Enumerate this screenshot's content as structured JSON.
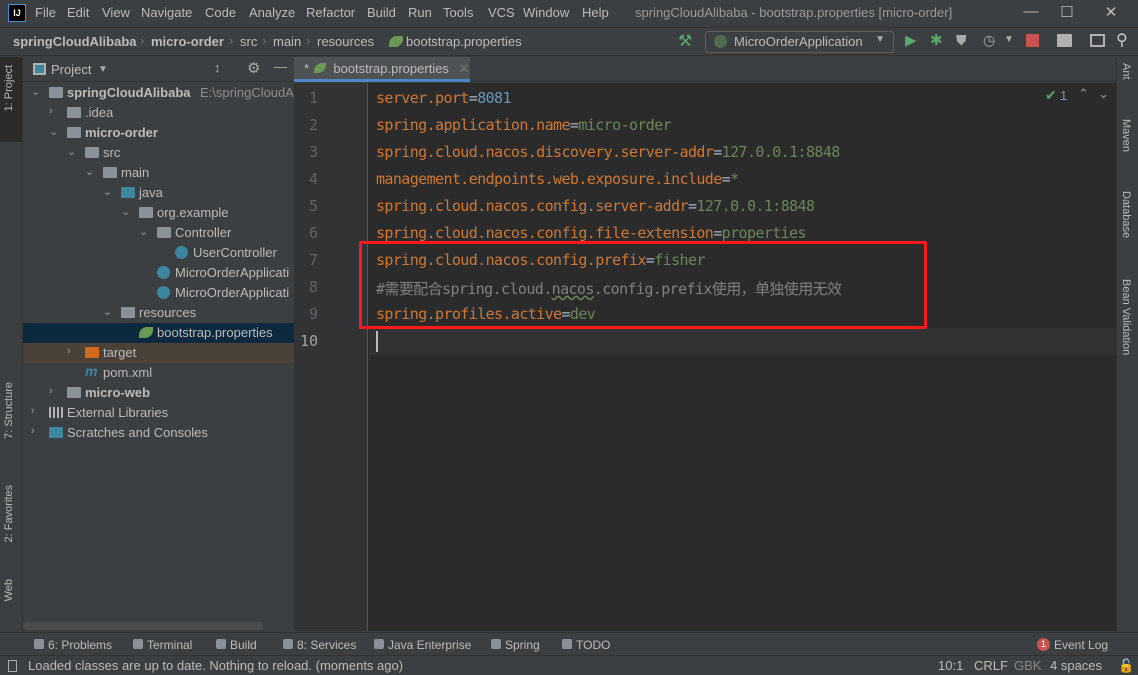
{
  "app": {
    "logo": "IJ",
    "window_title": "springCloudAlibaba - bootstrap.properties [micro-order]"
  },
  "menu": [
    "File",
    "Edit",
    "View",
    "Navigate",
    "Code",
    "Analyze",
    "Refactor",
    "Build",
    "Run",
    "Tools",
    "VCS",
    "Window",
    "Help"
  ],
  "breadcrumbs": [
    "springCloudAlibaba",
    "micro-order",
    "src",
    "main",
    "resources",
    "bootstrap.properties"
  ],
  "toolbar": {
    "run_config": "MicroOrderApplication"
  },
  "left_tabs": [
    "1: Project",
    "7: Structure",
    "2: Favorites",
    "Web"
  ],
  "right_tabs": [
    "Ant",
    "Maven",
    "Database",
    "Bean Validation"
  ],
  "project": {
    "title": "Project",
    "tree": [
      {
        "label": "springCloudAlibaba",
        "hint": "E:\\springCloudAli",
        "depth": 0,
        "state": "open",
        "icon": "module-folder",
        "bold": true
      },
      {
        "label": ".idea",
        "depth": 1,
        "state": "closed",
        "icon": "folder"
      },
      {
        "label": "micro-order",
        "depth": 1,
        "state": "open",
        "icon": "module-folder",
        "bold": true
      },
      {
        "label": "src",
        "depth": 2,
        "state": "open",
        "icon": "folder"
      },
      {
        "label": "main",
        "depth": 3,
        "state": "open",
        "icon": "folder"
      },
      {
        "label": "java",
        "depth": 4,
        "state": "open",
        "icon": "source-folder"
      },
      {
        "label": "org.example",
        "depth": 5,
        "state": "open",
        "icon": "package"
      },
      {
        "label": "Controller",
        "depth": 6,
        "state": "open",
        "icon": "package"
      },
      {
        "label": "UserController",
        "depth": 7,
        "state": "leaf",
        "icon": "class"
      },
      {
        "label": "MicroOrderApplicati",
        "depth": 6,
        "state": "leaf",
        "icon": "spring-boot-class"
      },
      {
        "label": "MicroOrderApplicati",
        "depth": 6,
        "state": "leaf",
        "icon": "spring-boot-class"
      },
      {
        "label": "resources",
        "depth": 4,
        "state": "open",
        "icon": "resources-folder"
      },
      {
        "label": "bootstrap.properties",
        "depth": 5,
        "state": "leaf",
        "icon": "spring-properties",
        "selected": true
      },
      {
        "label": "target",
        "depth": 2,
        "state": "closed",
        "icon": "excluded-folder",
        "excluded": true
      },
      {
        "label": "pom.xml",
        "depth": 2,
        "state": "leaf",
        "icon": "maven"
      },
      {
        "label": "micro-web",
        "depth": 1,
        "state": "closed",
        "icon": "module-folder",
        "bold": true
      },
      {
        "label": "External Libraries",
        "depth": 0,
        "state": "closed",
        "icon": "libraries"
      },
      {
        "label": "Scratches and Consoles",
        "depth": 0,
        "state": "closed",
        "icon": "scratches"
      }
    ]
  },
  "editor": {
    "tab": "bootstrap.properties",
    "tab_modified": "*",
    "inspection_count": "1",
    "lines": [
      [
        {
          "t": "server.port",
          "c": "k"
        },
        {
          "t": "=",
          "c": "o"
        },
        {
          "t": "8081",
          "c": "n"
        }
      ],
      [
        {
          "t": "spring.application.name",
          "c": "k"
        },
        {
          "t": "=",
          "c": "o"
        },
        {
          "t": "micro-order",
          "c": "s"
        }
      ],
      [
        {
          "t": "spring.cloud.nacos.discovery.server-addr",
          "c": "k"
        },
        {
          "t": "=",
          "c": "o"
        },
        {
          "t": "127.0.0.1:8848",
          "c": "s"
        }
      ],
      [
        {
          "t": "management.endpoints.web.exposure.include",
          "c": "k"
        },
        {
          "t": "=",
          "c": "o"
        },
        {
          "t": "*",
          "c": "s"
        }
      ],
      [
        {
          "t": "spring.cloud.nacos.config.server-addr",
          "c": "k"
        },
        {
          "t": "=",
          "c": "o"
        },
        {
          "t": "127.0.0.1:8848",
          "c": "s"
        }
      ],
      [
        {
          "t": "spring.cloud.nacos.config.file-extension",
          "c": "k"
        },
        {
          "t": "=",
          "c": "o"
        },
        {
          "t": "properties",
          "c": "s"
        }
      ],
      [
        {
          "t": "spring.cloud.nacos.config.prefix",
          "c": "k"
        },
        {
          "t": "=",
          "c": "o"
        },
        {
          "t": "fisher",
          "c": "s"
        }
      ],
      [
        {
          "t": "#需要配合spring.cloud.",
          "c": "c"
        },
        {
          "t": "nacos",
          "c": "c u"
        },
        {
          "t": ".config.prefix使用，单独使用无效",
          "c": "c"
        }
      ],
      [
        {
          "t": "spring.profiles.active",
          "c": "k"
        },
        {
          "t": "=",
          "c": "o"
        },
        {
          "t": "dev",
          "c": "s"
        }
      ],
      []
    ],
    "current_line": 10
  },
  "tool_windows": [
    "6: Problems",
    "Terminal",
    "Build",
    "8: Services",
    "Java Enterprise",
    "Spring",
    "TODO"
  ],
  "event_log": {
    "label": "Event Log",
    "count": "1"
  },
  "status": {
    "message": "Loaded classes are up to date. Nothing to reload. (moments ago)",
    "position": "10:1",
    "line_sep": "CRLF",
    "encoding": "GBK",
    "indent": "4 spaces"
  },
  "colors": {
    "accent": "#4A88C7",
    "highlight_box": "#FF1A1A",
    "keyword": "#CC7832",
    "string": "#6A8759",
    "number": "#6897BB",
    "comment": "#808080"
  }
}
